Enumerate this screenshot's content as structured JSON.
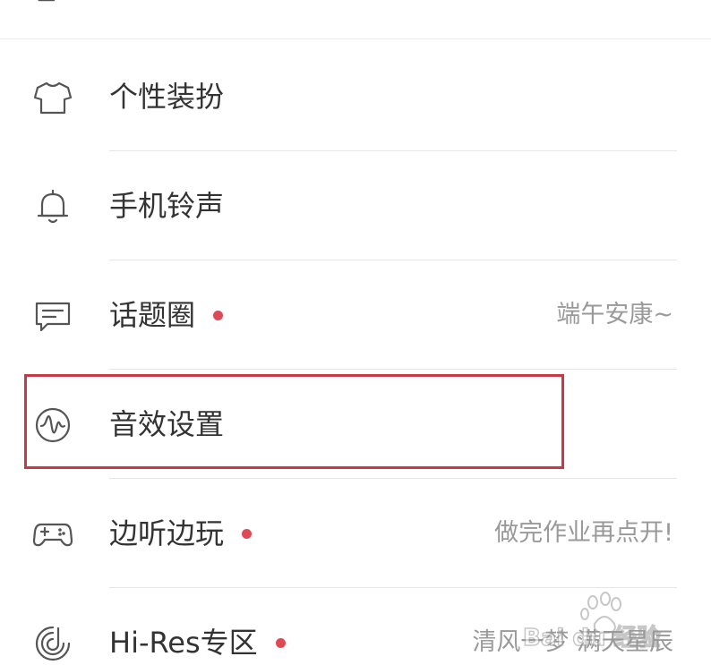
{
  "menu": {
    "items": [
      {
        "id": "personalize",
        "label": "个性装扮",
        "icon": "tshirt-icon",
        "has_dot": false,
        "value": ""
      },
      {
        "id": "ringtone",
        "label": "手机铃声",
        "icon": "bell-icon",
        "has_dot": false,
        "value": ""
      },
      {
        "id": "topics",
        "label": "话题圈",
        "icon": "chat-icon",
        "has_dot": true,
        "value": "端午安康~"
      },
      {
        "id": "sound-effects",
        "label": "音效设置",
        "icon": "waveform-icon",
        "has_dot": false,
        "value": "",
        "highlighted": true
      },
      {
        "id": "play-while-listening",
        "label": "边听边玩",
        "icon": "gamepad-icon",
        "has_dot": true,
        "value": "做完作业再点开!"
      },
      {
        "id": "hi-res",
        "label": "Hi-Res专区",
        "icon": "hi-res-icon",
        "has_dot": true,
        "value": "清风一梦 满天星辰"
      }
    ]
  },
  "watermark": {
    "text": "Bai du 经验",
    "icon": "paw-icon"
  },
  "colors": {
    "dot": "#dd4a55",
    "highlight": "#c73945",
    "label": "#333333",
    "value": "#999999",
    "icon": "#555555"
  }
}
